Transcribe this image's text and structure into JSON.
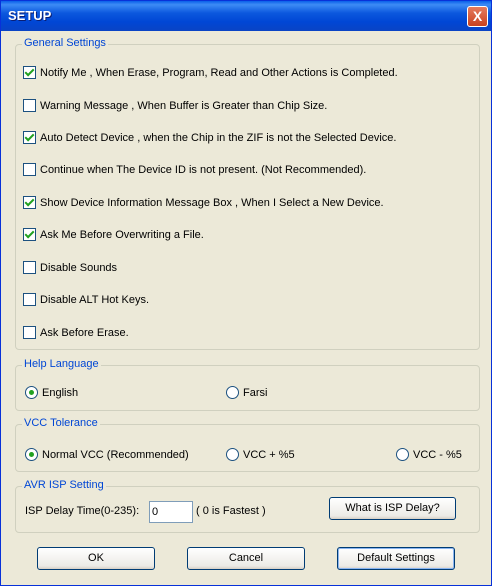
{
  "window": {
    "title": "SETUP",
    "close_label": "X"
  },
  "general": {
    "legend": "General Settings",
    "items": [
      {
        "label": "Notify Me , When Erase, Program, Read and Other Actions is Completed.",
        "checked": true
      },
      {
        "label": "Warning Message , When Buffer is Greater than Chip Size.",
        "checked": false
      },
      {
        "label": "Auto Detect Device , when the Chip in the ZIF is not the Selected  Device.",
        "checked": true
      },
      {
        "label": "Continue when The Device ID is not present. (Not Recommended).",
        "checked": false
      },
      {
        "label": "Show Device Information Message Box , When I Select a New Device.",
        "checked": true
      },
      {
        "label": "Ask Me Before Overwriting a File.",
        "checked": true
      },
      {
        "label": "Disable Sounds",
        "checked": false
      },
      {
        "label": "Disable  ALT Hot Keys.",
        "checked": false
      },
      {
        "label": "Ask Before Erase.",
        "checked": false
      }
    ]
  },
  "help_language": {
    "legend": "Help Language",
    "options": [
      {
        "label": "English",
        "selected": true
      },
      {
        "label": "Farsi",
        "selected": false
      }
    ]
  },
  "vcc": {
    "legend": "VCC Tolerance",
    "options": [
      {
        "label": "Normal VCC (Recommended)",
        "selected": true
      },
      {
        "label": "VCC + %5",
        "selected": false
      },
      {
        "label": "VCC - %5",
        "selected": false
      }
    ]
  },
  "isp": {
    "legend": "AVR ISP Setting",
    "delay_label": "ISP Delay Time(0-235):",
    "delay_value": "0",
    "hint": "( 0  is Fastest )",
    "help_button": "What is ISP Delay?"
  },
  "footer": {
    "ok": "OK",
    "cancel": "Cancel",
    "defaults": "Default Settings"
  }
}
